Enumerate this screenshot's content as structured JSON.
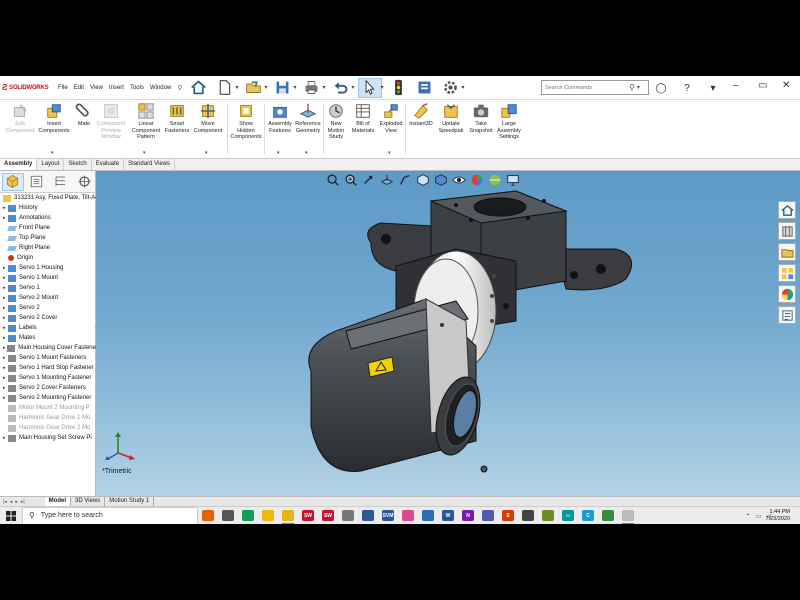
{
  "app": {
    "logo_text": "SOLIDWORKS",
    "menus": [
      "File",
      "Edit",
      "View",
      "Insert",
      "Tools",
      "Window"
    ],
    "search_placeholder": "Search Commands"
  },
  "command_manager": [
    {
      "label": "Edit\nComponent",
      "icon": "edit-component-icon",
      "enabled": false
    },
    {
      "label": "Insert\nComponents",
      "icon": "insert-components-icon",
      "enabled": true
    },
    {
      "label": "Mate",
      "icon": "mate-icon",
      "enabled": true
    },
    {
      "label": "Component\nPreview\nWindow",
      "icon": "component-preview-icon",
      "enabled": false
    },
    {
      "label": "Linear\nComponent\nPattern",
      "icon": "linear-pattern-icon",
      "enabled": true
    },
    {
      "label": "Smart\nFasteners",
      "icon": "smart-fasteners-icon",
      "enabled": true
    },
    {
      "label": "Move\nComponent",
      "icon": "move-component-icon",
      "enabled": true
    },
    {
      "label": "Show\nHidden\nComponents",
      "icon": "show-hidden-icon",
      "enabled": true
    },
    {
      "label": "Assembly\nFeatures",
      "icon": "assembly-features-icon",
      "enabled": true
    },
    {
      "label": "Reference\nGeometry",
      "icon": "reference-geometry-icon",
      "enabled": true
    },
    {
      "label": "New\nMotion\nStudy",
      "icon": "motion-study-icon",
      "enabled": true
    },
    {
      "label": "Bill of\nMaterials",
      "icon": "bom-icon",
      "enabled": true
    },
    {
      "label": "Exploded\nView",
      "icon": "exploded-view-icon",
      "enabled": true
    },
    {
      "label": "Instant3D",
      "icon": "instant3d-icon",
      "enabled": true
    },
    {
      "label": "Update\nSpeedpak",
      "icon": "speedpak-icon",
      "enabled": true
    },
    {
      "label": "Take\nSnapshot",
      "icon": "snapshot-icon",
      "enabled": true
    },
    {
      "label": "Large\nAssembly\nSettings",
      "icon": "large-assembly-icon",
      "enabled": true
    }
  ],
  "tabs": [
    "Assembly",
    "Layout",
    "Sketch",
    "Evaluate",
    "Standard Views"
  ],
  "tree": [
    {
      "label": "313231 Asy, Fixed Plate, Tilt-A-",
      "type": "root",
      "arrow": ""
    },
    {
      "label": "History",
      "type": "folder",
      "arrow": "▸"
    },
    {
      "label": "Annotations",
      "type": "folder",
      "arrow": "▸"
    },
    {
      "label": "Front Plane",
      "type": "plane",
      "arrow": ""
    },
    {
      "label": "Top Plane",
      "type": "plane",
      "arrow": ""
    },
    {
      "label": "Right Plane",
      "type": "plane",
      "arrow": ""
    },
    {
      "label": "Origin",
      "type": "origin",
      "arrow": ""
    },
    {
      "label": "Servo 1 Housing",
      "type": "folder",
      "arrow": "▸"
    },
    {
      "label": "Servo 1 Mount",
      "type": "folder",
      "arrow": "▸"
    },
    {
      "label": "Servo 1",
      "type": "folder",
      "arrow": "▸"
    },
    {
      "label": "Servo 2 Mount",
      "type": "folder",
      "arrow": "▸"
    },
    {
      "label": "Servo 2",
      "type": "folder",
      "arrow": "▸"
    },
    {
      "label": "Servo 2 Cover",
      "type": "folder",
      "arrow": "▸"
    },
    {
      "label": "Labels",
      "type": "folder",
      "arrow": "▸"
    },
    {
      "label": "Mates",
      "type": "folder",
      "arrow": "▸"
    },
    {
      "label": "Main Housing Cover Fastene",
      "type": "pattern",
      "arrow": "▸"
    },
    {
      "label": "Servo 1 Mount Fasteners",
      "type": "pattern",
      "arrow": "▸"
    },
    {
      "label": "Servo 1 Hard Stop Fastener",
      "type": "pattern",
      "arrow": "▸"
    },
    {
      "label": "Servo 1 Mounting Fastener",
      "type": "pattern",
      "arrow": "▸"
    },
    {
      "label": "Servo 2 Cover Fasteners",
      "type": "pattern",
      "arrow": "▸"
    },
    {
      "label": "Servo 2 Mounting Fastener",
      "type": "pattern",
      "arrow": "▸"
    },
    {
      "label": "Motor Mount 2 Mounting P",
      "type": "dim",
      "arrow": ""
    },
    {
      "label": "Harmonic Gear Drive 1 Mo",
      "type": "dim",
      "arrow": ""
    },
    {
      "label": "Harmonic Gear Drive 2 Mo",
      "type": "dim",
      "arrow": ""
    },
    {
      "label": "Main Housing Set Screw Pi",
      "type": "pattern",
      "arrow": "▸"
    }
  ],
  "view": {
    "orientation_label": "*Trimetric"
  },
  "bottom_tabs": [
    "Model",
    "3D Views",
    "Motion Study 1"
  ],
  "taskbar": {
    "search_placeholder": "Type here to search",
    "apps": [
      {
        "name": "firefox-icon",
        "color": "#e66000",
        "text": ""
      },
      {
        "name": "mail-icon",
        "color": "#555555",
        "text": ""
      },
      {
        "name": "hangouts-icon",
        "color": "#0f9d58",
        "text": ""
      },
      {
        "name": "norton-icon",
        "color": "#f2b705",
        "text": ""
      },
      {
        "name": "file-explorer-icon",
        "color": "#e7b416",
        "text": ""
      },
      {
        "name": "solidworks-icon",
        "color": "#c8102e",
        "text": "SW"
      },
      {
        "name": "solidworks-2-icon",
        "color": "#c8102e",
        "text": "SW"
      },
      {
        "name": "app-icon",
        "color": "#777777",
        "text": ""
      },
      {
        "name": "app-2-icon",
        "color": "#2b5797",
        "text": ""
      },
      {
        "name": "sw-visualize-icon",
        "color": "#2b5797",
        "text": "SVM"
      },
      {
        "name": "itunes-icon",
        "color": "#d94a8c",
        "text": ""
      },
      {
        "name": "photos-icon",
        "color": "#2c6cb4",
        "text": ""
      },
      {
        "name": "word-icon",
        "color": "#2b579a",
        "text": "W"
      },
      {
        "name": "onenote-icon",
        "color": "#7719aa",
        "text": "N"
      },
      {
        "name": "teams-icon",
        "color": "#5558af",
        "text": ""
      },
      {
        "name": "app-s-icon",
        "color": "#d83b01",
        "text": "S"
      },
      {
        "name": "app-doc-icon",
        "color": "#444444",
        "text": ""
      },
      {
        "name": "app-calc-icon",
        "color": "#6b8e23",
        "text": ""
      },
      {
        "name": "arduino-icon",
        "color": "#00979c",
        "text": "∞"
      },
      {
        "name": "ccleaner-icon",
        "color": "#1c9bd6",
        "text": "C"
      },
      {
        "name": "app-note-icon",
        "color": "#3a8a3a",
        "text": ""
      },
      {
        "name": "app-active-icon",
        "color": "#bbbbbb",
        "text": ""
      }
    ],
    "time": "1:44 PM",
    "date": "7/23/2020"
  },
  "colors": {
    "accent": "#c8102e",
    "viewport_top": "#5d9ac6",
    "viewport_bottom": "#b6d3e6"
  }
}
